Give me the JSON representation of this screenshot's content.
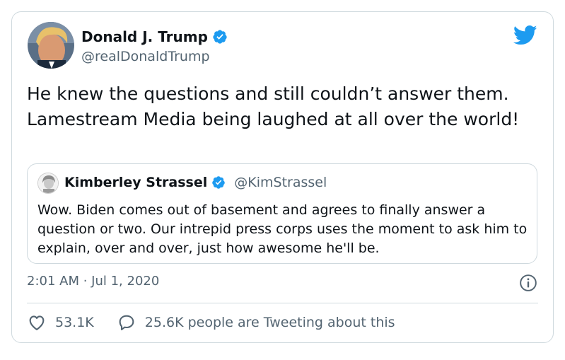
{
  "tweet": {
    "author": {
      "display_name": "Donald J. Trump",
      "handle": "@realDonaldTrump",
      "verified": true
    },
    "text": "He knew the questions and still couldn’t answer them. Lamestream Media being laughed at all over the world!",
    "timestamp": "2:01 AM · Jul 1, 2020",
    "likes": "53.1K",
    "conversation": "25.6K people are Tweeting about this"
  },
  "quoted_tweet": {
    "author": {
      "display_name": "Kimberley Strassel",
      "handle": "@KimStrassel",
      "verified": true
    },
    "text": "Wow. Biden comes out of basement and agrees to finally answer a question or two. Our intrepid press corps uses the moment to ask him to explain, over and over, just how awesome he'll be."
  },
  "icons": {
    "logo": "twitter-bird-icon",
    "verified": "verified-badge-icon",
    "info": "info-icon",
    "like": "heart-icon",
    "reply": "speech-bubble-icon"
  },
  "colors": {
    "accent": "#1d9bf0",
    "text": "#0f1419",
    "secondary": "#536471",
    "border": "#cfd9de"
  }
}
